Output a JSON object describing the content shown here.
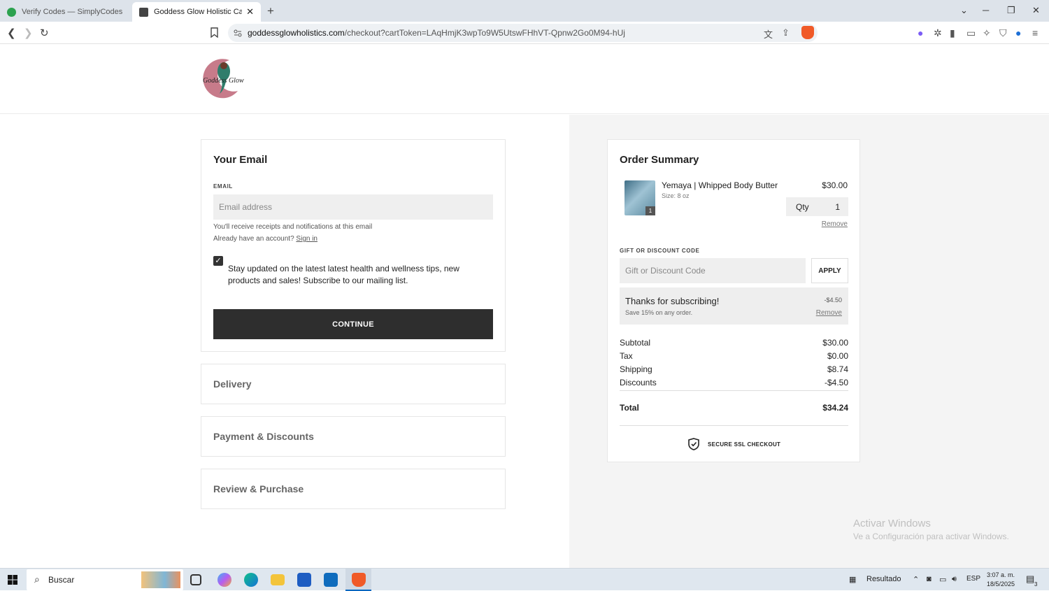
{
  "browser": {
    "tabs": [
      {
        "title": "Verify Codes — SimplyCodes",
        "active": false,
        "icon": "simplycodes-icon"
      },
      {
        "title": "Goddess Glow Holistic Care | Se",
        "active": true,
        "icon": "store-icon"
      }
    ],
    "url_domain": "goddessglowholistics.com",
    "url_path": "/checkout?cartToken=LAqHmjK3wpTo9W5UtswFHhVT-Qpnw2Go0M94-hUj"
  },
  "site": {
    "logo_text": "Goddess Glow"
  },
  "email_section": {
    "title": "Your Email",
    "label": "EMAIL",
    "placeholder": "Email address",
    "help_text": "You'll receive receipts and notifications at this email",
    "account_prompt": "Already have an account?",
    "signin_link": "Sign in",
    "subscribe_checked": true,
    "subscribe_text": "Stay updated on the latest latest health and wellness tips, new products and sales! Subscribe to our mailing list.",
    "continue_label": "CONTINUE"
  },
  "steps": [
    {
      "title": "Delivery"
    },
    {
      "title": "Payment & Discounts"
    },
    {
      "title": "Review & Purchase"
    }
  ],
  "order_summary": {
    "title": "Order Summary",
    "item": {
      "name": "Yemaya | Whipped Body Butter",
      "size": "Size: 8 oz",
      "price": "$30.00",
      "badge_count": "1",
      "qty_label": "Qty",
      "qty_value": "1",
      "remove_label": "Remove"
    },
    "discount_label": "GIFT OR DISCOUNT CODE",
    "discount_placeholder": "Gift or Discount Code",
    "apply_label": "APPLY",
    "promo": {
      "title": "Thanks for subscribing!",
      "subtitle": "Save 15% on any order.",
      "amount": "-$4.50",
      "remove_label": "Remove"
    },
    "totals": [
      {
        "label": "Subtotal",
        "value": "$30.00"
      },
      {
        "label": "Tax",
        "value": "$0.00"
      },
      {
        "label": "Shipping",
        "value": "$8.74"
      },
      {
        "label": "Discounts",
        "value": "-$4.50"
      }
    ],
    "total_label": "Total",
    "total_value": "$34.24",
    "secure_text": "SECURE SSL CHECKOUT"
  },
  "watermark": {
    "line1": "Activar Windows",
    "line2": "Ve a Configuración para activar Windows."
  },
  "taskbar": {
    "search_text": "Buscar",
    "weather": "Resultado",
    "language": "ESP",
    "time": "3:07 a. m.",
    "date": "18/5/2025",
    "notification_count": "3"
  }
}
